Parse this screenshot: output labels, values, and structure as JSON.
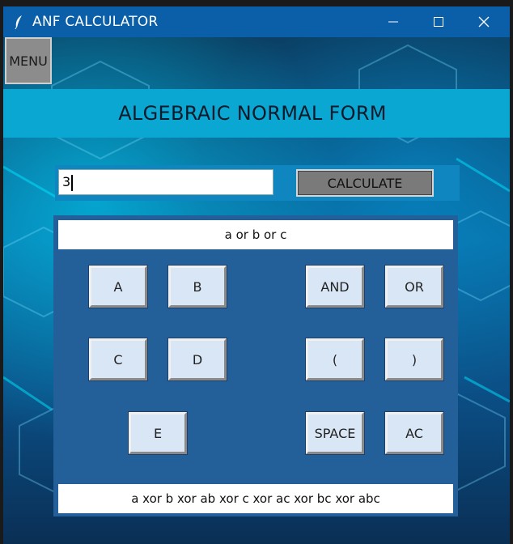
{
  "window": {
    "title": "ANF CALCULATOR",
    "icons": {
      "app": "feather-icon",
      "minimize": "minimize-icon",
      "maximize": "maximize-icon",
      "close": "close-icon"
    }
  },
  "menu": {
    "label": "MENU"
  },
  "header": {
    "title": "ALGEBRAIC NORMAL FORM"
  },
  "input": {
    "value": "3",
    "placeholder": ""
  },
  "calculate": {
    "label": "CALCULATE"
  },
  "expression": "a or b or c",
  "result": "a xor b xor ab xor c xor ac xor bc xor abc",
  "keys": {
    "a": "A",
    "b": "B",
    "c": "C",
    "d": "D",
    "e": "E",
    "and": "AND",
    "or": "OR",
    "lparen": "(",
    "rparen": ")",
    "space": "SPACE",
    "ac": "AC"
  },
  "colors": {
    "titlebar": "#0b5fa8",
    "banner": "#0aa7d3",
    "panel": "#235f99",
    "key": "#d8e6f5"
  }
}
